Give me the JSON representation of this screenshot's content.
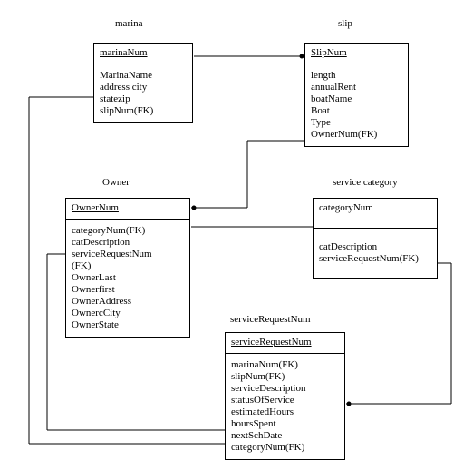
{
  "entities": {
    "marina": {
      "title": "marina",
      "key": "marinaNum",
      "attrs": [
        "MarinaName",
        "address city",
        "statezip",
        "slipNum(FK)"
      ]
    },
    "slip": {
      "title": "slip",
      "key": "SlipNum",
      "attrs": [
        "length",
        "annualRent",
        "boatName",
        "Boat",
        "Type",
        "OwnerNum(FK)"
      ]
    },
    "owner": {
      "title": "Owner",
      "key": "OwnerNum",
      "attrs": [
        "categoryNum(FK)",
        "catDescription",
        "serviceRequestNum",
        "(FK)",
        "OwnerLast",
        "Ownerfirst",
        "OwnerAddress",
        "OwnercCity",
        "OwnerState"
      ]
    },
    "serviceCategory": {
      "title": "service category",
      "key": "categoryNum",
      "attrs": [
        "catDescription",
        "serviceRequestNum(FK)"
      ]
    },
    "serviceRequest": {
      "title": "serviceRequestNum",
      "key": "serviceRequestNum",
      "attrs": [
        "marinaNum(FK)",
        "slipNum(FK)",
        "serviceDescription",
        "statusOfService",
        "estimatedHours",
        "hoursSpent",
        "nextSchDate",
        "categoryNum(FK)"
      ]
    }
  }
}
